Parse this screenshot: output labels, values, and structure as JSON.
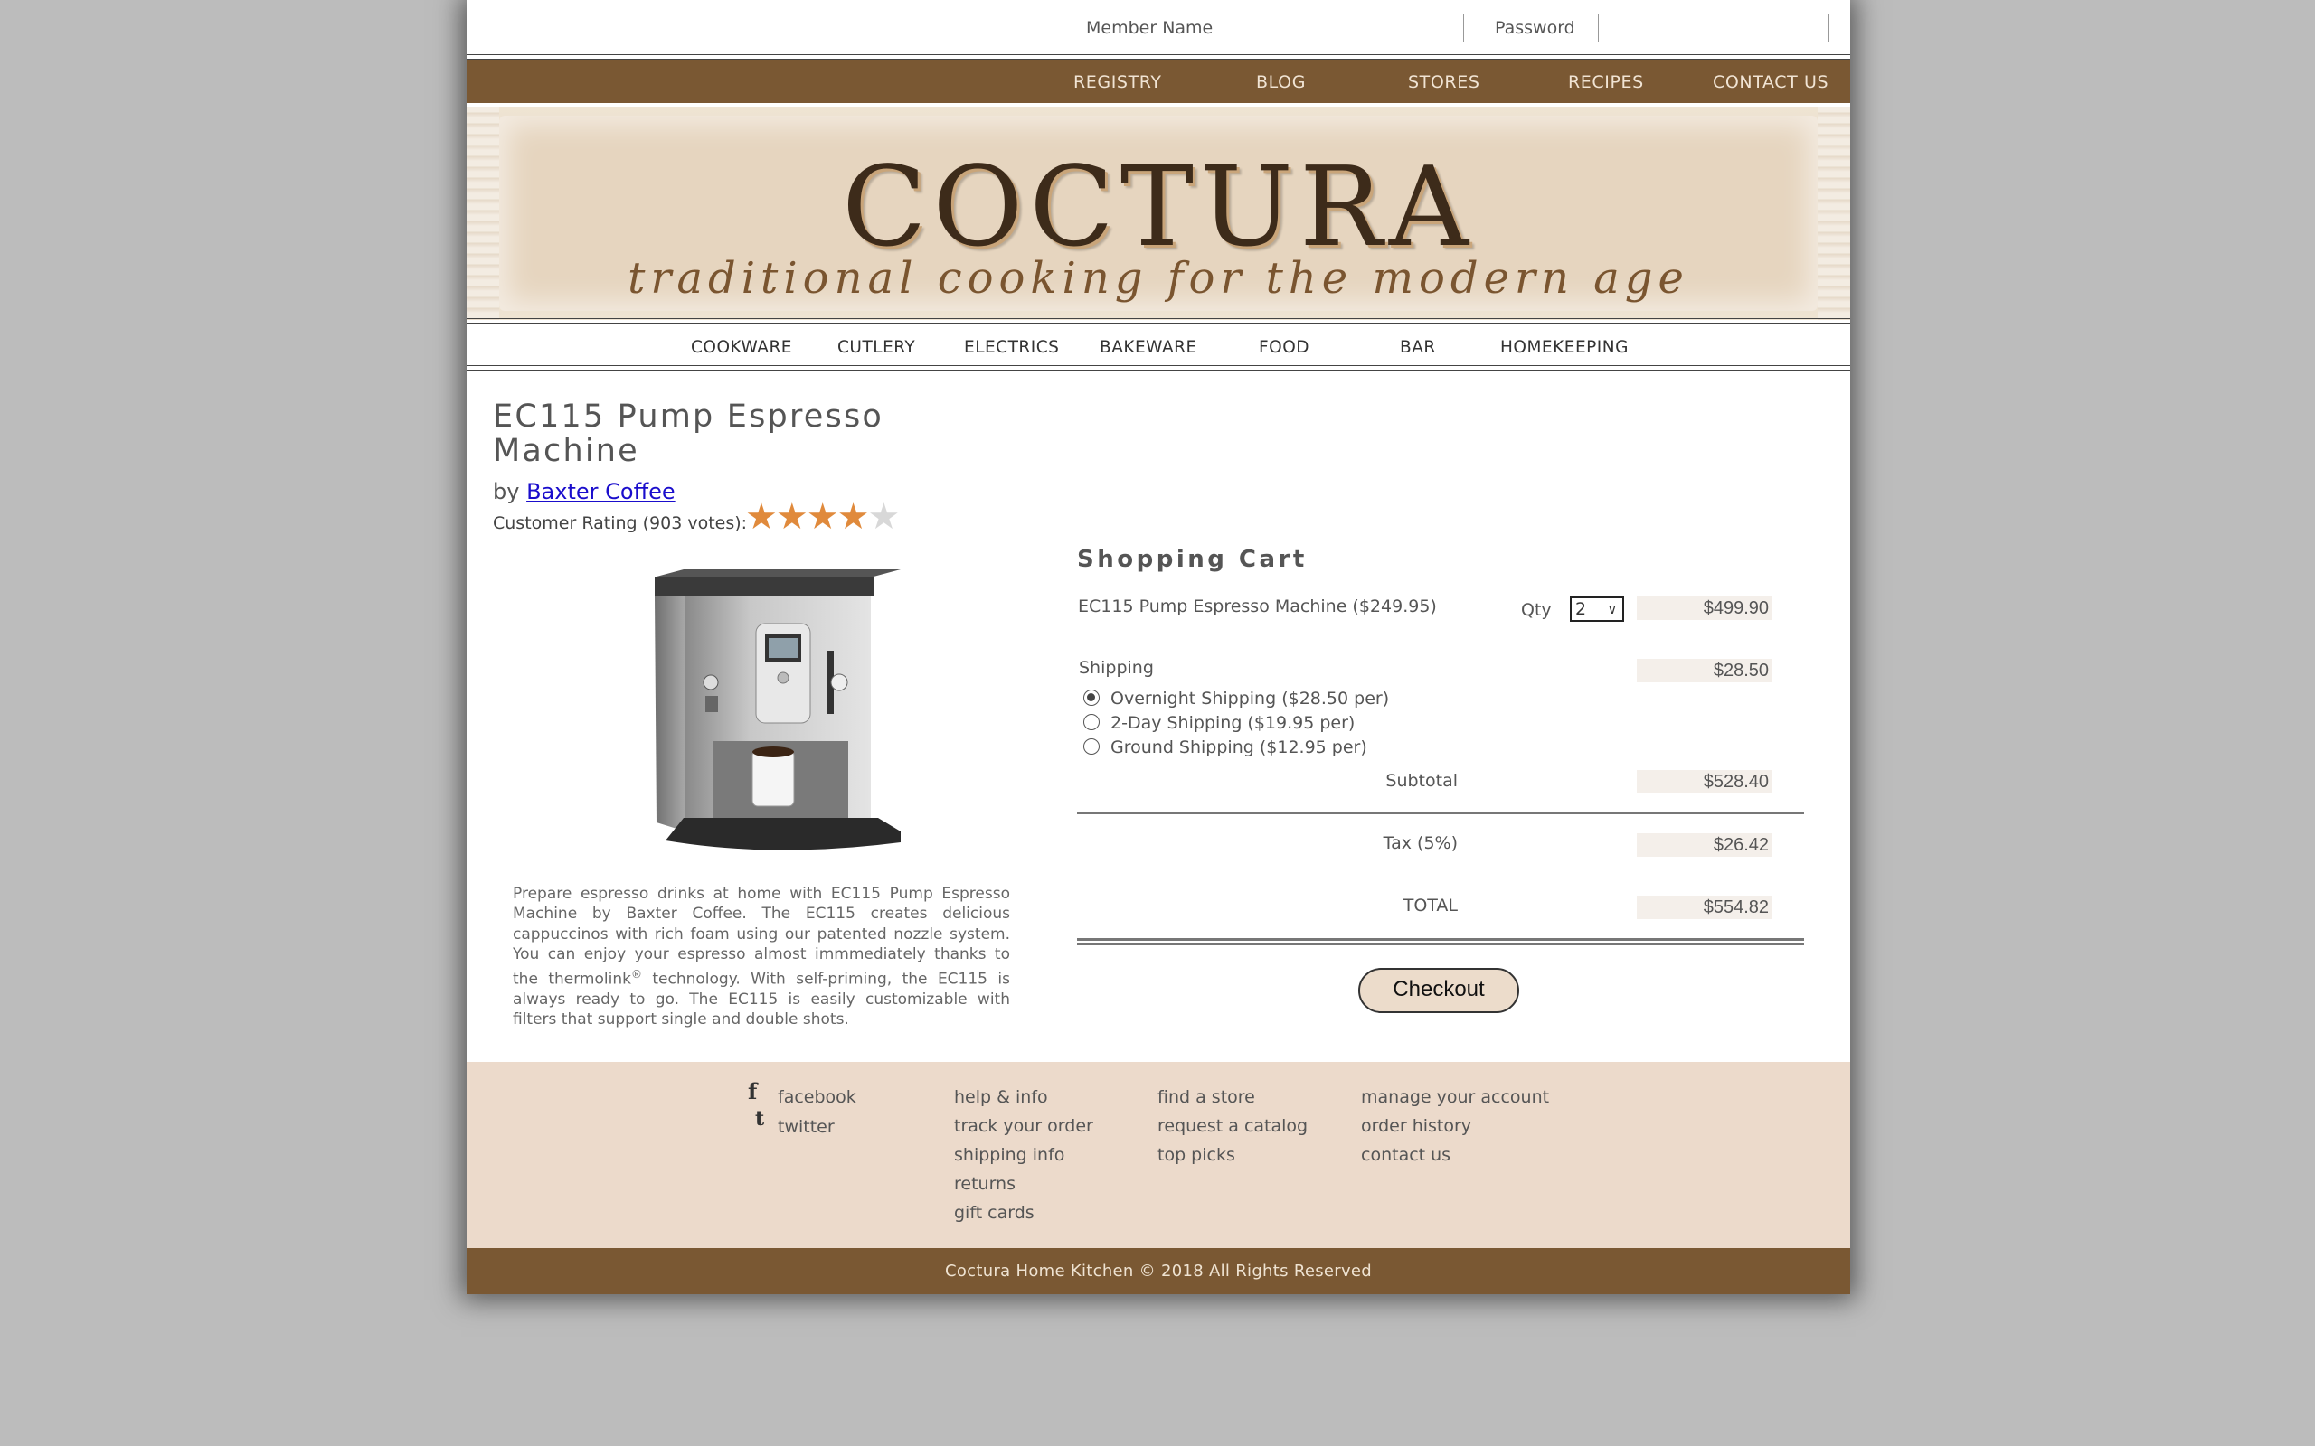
{
  "login": {
    "member_label": "Member Name",
    "member_value": "",
    "password_label": "Password",
    "password_value": ""
  },
  "top_nav": [
    "REGISTRY",
    "BLOG",
    "STORES",
    "RECIPES",
    "CONTACT US"
  ],
  "banner": {
    "title": "COCTURA",
    "tagline": "traditional cooking for the modern age"
  },
  "categories": [
    "COOKWARE",
    "CUTLERY",
    "ELECTRICS",
    "BAKEWARE",
    "FOOD",
    "BAR",
    "HOMEKEEPING"
  ],
  "product": {
    "title": "EC115 Pump Espresso Machine",
    "by_prefix": "by",
    "brand": "Baxter Coffee",
    "rating_label": "Customer Rating (903 votes):",
    "rating_stars": 4,
    "rating_max": 5,
    "description_part1": "Prepare espresso drinks at home with EC115 Pump Espresso Machine by Baxter Coffee. The EC115 creates delicious cappuccinos with rich foam using our patented nozzle system. You can enjoy your espresso almost immmediately thanks to the thermolink",
    "description_sup": "®",
    "description_part2": " technology. With self-priming, the EC115 is always ready to go. The EC115 is easily customizable with filters that support single and double shots."
  },
  "cart": {
    "title": "Shopping Cart",
    "item_label": "EC115 Pump Espresso Machine ($249.95)",
    "qty_label": "Qty",
    "qty_value": "2",
    "item_total": "$499.90",
    "shipping_label": "Shipping",
    "shipping_amount": "$28.50",
    "shipping_options": [
      {
        "label": "Overnight Shipping ($28.50 per)",
        "selected": true
      },
      {
        "label": "2-Day Shipping ($19.95 per)",
        "selected": false
      },
      {
        "label": "Ground Shipping ($12.95 per)",
        "selected": false
      }
    ],
    "subtotal_label": "Subtotal",
    "subtotal": "$528.40",
    "tax_label": "Tax (5%)",
    "tax": "$26.42",
    "total_label": "TOTAL",
    "total": "$554.82",
    "checkout_label": "Checkout"
  },
  "footer": {
    "social": [
      {
        "label": "facebook",
        "icon": "facebook-icon"
      },
      {
        "label": "twitter",
        "icon": "twitter-icon"
      }
    ],
    "col1": [
      "help & info",
      "track your order",
      "shipping info",
      "returns",
      "gift cards"
    ],
    "col2": [
      "find a store",
      "request a catalog",
      "top picks"
    ],
    "col3": [
      "manage your account",
      "order history",
      "contact us"
    ],
    "copyright": "Coctura Home Kitchen © 2018 All Rights Reserved"
  },
  "colors": {
    "brand_brown": "#7a5833",
    "banner_bg": "#e6d5bf",
    "footer_bg": "#ecdacb",
    "star_on": "#e08a3c",
    "link_blue": "#1a0dcc"
  }
}
